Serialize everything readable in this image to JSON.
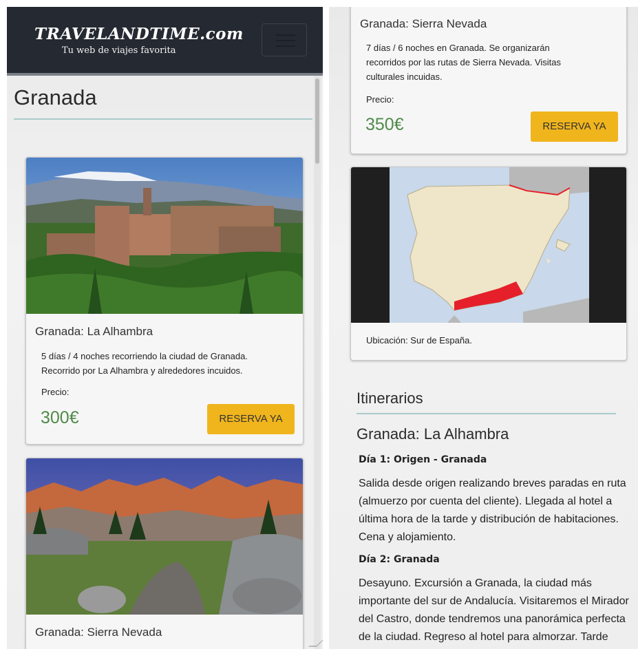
{
  "header": {
    "brand": "TRAVELANDTIME.com",
    "tagline": "Tu web de viajes favorita"
  },
  "page": {
    "title": "Granada"
  },
  "cards": [
    {
      "title": "Granada: La Alhambra",
      "description": "5 días / 4 noches recorriendo la ciudad de Granada. Recorrido por La Alhambra y alrededores incuidos.",
      "price_label": "Precio:",
      "price": "300€",
      "button": "RESERVA YA"
    },
    {
      "title": "Granada: Sierra Nevada",
      "description": "7 días / 6 noches en Granada. Se organizarán recorridos por las rutas de Sierra Nevada. Visitas culturales incuidas.",
      "price_label": "Precio:",
      "price": "350€",
      "button": "RESERVA YA"
    }
  ],
  "location": {
    "caption": "Ubicación: Sur de España."
  },
  "itinerary": {
    "section_title": "Itinerarios",
    "trip_title": "Granada: La Alhambra",
    "days": [
      {
        "title": "Día 1: Origen - Granada",
        "text": "Salida desde origen realizando breves paradas en ruta (almuerzo por cuenta del cliente). Llegada al hotel a última hora de la tarde y distribución de habitaciones. Cena y alojamiento."
      },
      {
        "title": "Día 2: Granada",
        "text": "Desayuno. Excursión a Granada, la ciudad más importante del sur de Andalucía. Visitaremos el Mirador del Castro, donde tendremos una panorámica perfecta de la ciudad. Regreso al hotel para almorzar. Tarde libre con posibilidad de"
      }
    ]
  },
  "colors": {
    "navbar": "#252932",
    "accent_button": "#f0b51d",
    "price": "#4f8a48",
    "rule": "#a9cbc9",
    "region_highlight": "#e5202a"
  }
}
